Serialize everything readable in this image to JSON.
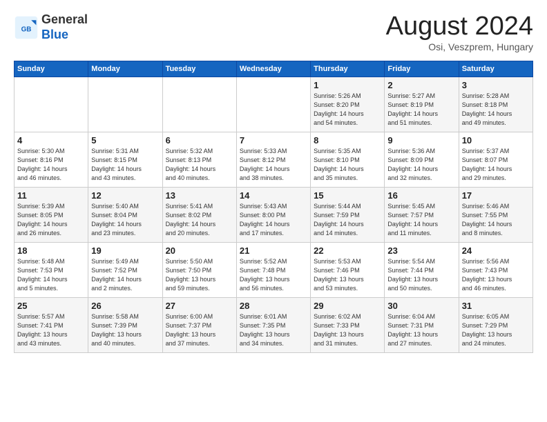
{
  "header": {
    "logo_general": "General",
    "logo_blue": "Blue",
    "month_title": "August 2024",
    "location": "Osi, Veszprem, Hungary"
  },
  "weekdays": [
    "Sunday",
    "Monday",
    "Tuesday",
    "Wednesday",
    "Thursday",
    "Friday",
    "Saturday"
  ],
  "weeks": [
    [
      {
        "day": "",
        "info": ""
      },
      {
        "day": "",
        "info": ""
      },
      {
        "day": "",
        "info": ""
      },
      {
        "day": "",
        "info": ""
      },
      {
        "day": "1",
        "info": "Sunrise: 5:26 AM\nSunset: 8:20 PM\nDaylight: 14 hours\nand 54 minutes."
      },
      {
        "day": "2",
        "info": "Sunrise: 5:27 AM\nSunset: 8:19 PM\nDaylight: 14 hours\nand 51 minutes."
      },
      {
        "day": "3",
        "info": "Sunrise: 5:28 AM\nSunset: 8:18 PM\nDaylight: 14 hours\nand 49 minutes."
      }
    ],
    [
      {
        "day": "4",
        "info": "Sunrise: 5:30 AM\nSunset: 8:16 PM\nDaylight: 14 hours\nand 46 minutes."
      },
      {
        "day": "5",
        "info": "Sunrise: 5:31 AM\nSunset: 8:15 PM\nDaylight: 14 hours\nand 43 minutes."
      },
      {
        "day": "6",
        "info": "Sunrise: 5:32 AM\nSunset: 8:13 PM\nDaylight: 14 hours\nand 40 minutes."
      },
      {
        "day": "7",
        "info": "Sunrise: 5:33 AM\nSunset: 8:12 PM\nDaylight: 14 hours\nand 38 minutes."
      },
      {
        "day": "8",
        "info": "Sunrise: 5:35 AM\nSunset: 8:10 PM\nDaylight: 14 hours\nand 35 minutes."
      },
      {
        "day": "9",
        "info": "Sunrise: 5:36 AM\nSunset: 8:09 PM\nDaylight: 14 hours\nand 32 minutes."
      },
      {
        "day": "10",
        "info": "Sunrise: 5:37 AM\nSunset: 8:07 PM\nDaylight: 14 hours\nand 29 minutes."
      }
    ],
    [
      {
        "day": "11",
        "info": "Sunrise: 5:39 AM\nSunset: 8:05 PM\nDaylight: 14 hours\nand 26 minutes."
      },
      {
        "day": "12",
        "info": "Sunrise: 5:40 AM\nSunset: 8:04 PM\nDaylight: 14 hours\nand 23 minutes."
      },
      {
        "day": "13",
        "info": "Sunrise: 5:41 AM\nSunset: 8:02 PM\nDaylight: 14 hours\nand 20 minutes."
      },
      {
        "day": "14",
        "info": "Sunrise: 5:43 AM\nSunset: 8:00 PM\nDaylight: 14 hours\nand 17 minutes."
      },
      {
        "day": "15",
        "info": "Sunrise: 5:44 AM\nSunset: 7:59 PM\nDaylight: 14 hours\nand 14 minutes."
      },
      {
        "day": "16",
        "info": "Sunrise: 5:45 AM\nSunset: 7:57 PM\nDaylight: 14 hours\nand 11 minutes."
      },
      {
        "day": "17",
        "info": "Sunrise: 5:46 AM\nSunset: 7:55 PM\nDaylight: 14 hours\nand 8 minutes."
      }
    ],
    [
      {
        "day": "18",
        "info": "Sunrise: 5:48 AM\nSunset: 7:53 PM\nDaylight: 14 hours\nand 5 minutes."
      },
      {
        "day": "19",
        "info": "Sunrise: 5:49 AM\nSunset: 7:52 PM\nDaylight: 14 hours\nand 2 minutes."
      },
      {
        "day": "20",
        "info": "Sunrise: 5:50 AM\nSunset: 7:50 PM\nDaylight: 13 hours\nand 59 minutes."
      },
      {
        "day": "21",
        "info": "Sunrise: 5:52 AM\nSunset: 7:48 PM\nDaylight: 13 hours\nand 56 minutes."
      },
      {
        "day": "22",
        "info": "Sunrise: 5:53 AM\nSunset: 7:46 PM\nDaylight: 13 hours\nand 53 minutes."
      },
      {
        "day": "23",
        "info": "Sunrise: 5:54 AM\nSunset: 7:44 PM\nDaylight: 13 hours\nand 50 minutes."
      },
      {
        "day": "24",
        "info": "Sunrise: 5:56 AM\nSunset: 7:43 PM\nDaylight: 13 hours\nand 46 minutes."
      }
    ],
    [
      {
        "day": "25",
        "info": "Sunrise: 5:57 AM\nSunset: 7:41 PM\nDaylight: 13 hours\nand 43 minutes."
      },
      {
        "day": "26",
        "info": "Sunrise: 5:58 AM\nSunset: 7:39 PM\nDaylight: 13 hours\nand 40 minutes."
      },
      {
        "day": "27",
        "info": "Sunrise: 6:00 AM\nSunset: 7:37 PM\nDaylight: 13 hours\nand 37 minutes."
      },
      {
        "day": "28",
        "info": "Sunrise: 6:01 AM\nSunset: 7:35 PM\nDaylight: 13 hours\nand 34 minutes."
      },
      {
        "day": "29",
        "info": "Sunrise: 6:02 AM\nSunset: 7:33 PM\nDaylight: 13 hours\nand 31 minutes."
      },
      {
        "day": "30",
        "info": "Sunrise: 6:04 AM\nSunset: 7:31 PM\nDaylight: 13 hours\nand 27 minutes."
      },
      {
        "day": "31",
        "info": "Sunrise: 6:05 AM\nSunset: 7:29 PM\nDaylight: 13 hours\nand 24 minutes."
      }
    ]
  ]
}
